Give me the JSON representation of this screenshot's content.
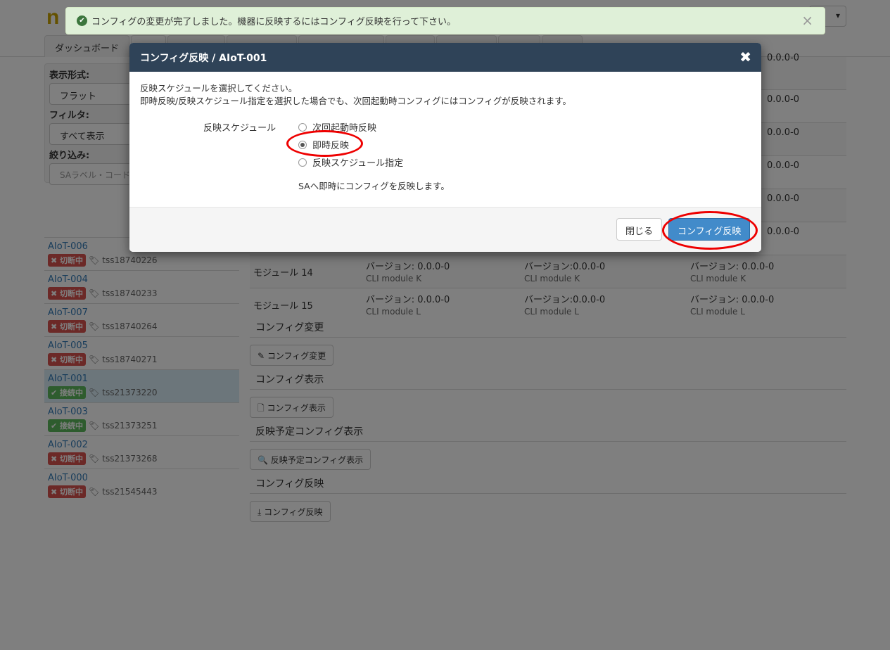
{
  "header": {
    "logo": "n",
    "user_menu": "▾"
  },
  "nav": {
    "tabs": [
      "ダッシュボード",
      "",
      "",
      "",
      "",
      "",
      "",
      "",
      ""
    ]
  },
  "left_panel": {
    "display_format_label": "表示形式:",
    "display_format_value": "フラット",
    "filter_label": "フィルタ:",
    "filter_value": "すべて表示",
    "narrow_label": "絞り込み:",
    "narrow_placeholder": "SAラベル・コード"
  },
  "devices": [
    {
      "name": "AIoT-006",
      "status": "切断中",
      "state": "off",
      "tag": "tss18740226"
    },
    {
      "name": "AIoT-004",
      "status": "切断中",
      "state": "off",
      "tag": "tss18740233"
    },
    {
      "name": "AIoT-007",
      "status": "切断中",
      "state": "off",
      "tag": "tss18740264"
    },
    {
      "name": "AIoT-005",
      "status": "切断中",
      "state": "off",
      "tag": "tss18740271"
    },
    {
      "name": "AIoT-001",
      "status": "接続中",
      "state": "on",
      "tag": "tss21373220"
    },
    {
      "name": "AIoT-003",
      "status": "接続中",
      "state": "on",
      "tag": "tss21373251"
    },
    {
      "name": "AIoT-002",
      "status": "切断中",
      "state": "off",
      "tag": "tss21373268"
    },
    {
      "name": "AIoT-000",
      "status": "切断中",
      "state": "off",
      "tag": "tss21545443"
    }
  ],
  "modules": {
    "partial_rows": [
      "0.0.0-0",
      "0.0.0-0",
      "0.0.0-0",
      "0.0.0-0",
      "0.0.0-0",
      "0.0.0-0"
    ],
    "rows": [
      {
        "name": "モジュール 14",
        "version": "バージョン: 0.0.0-0",
        "version_b": "バージョン:0.0.0-0",
        "sub": "CLI module K"
      },
      {
        "name": "モジュール 15",
        "version": "バージョン: 0.0.0-0",
        "version_b": "バージョン:0.0.0-0",
        "sub": "CLI module L"
      }
    ]
  },
  "sections": [
    {
      "title": "コンフィグ変更",
      "button": "✎ コンフィグ変更"
    },
    {
      "title": "コンフィグ表示",
      "button": "🗋 コンフィグ表示"
    },
    {
      "title": "反映予定コンフィグ表示",
      "button": "🔍 反映予定コンフィグ表示"
    },
    {
      "title": "コンフィグ反映",
      "button": "⤓ コンフィグ反映"
    }
  ],
  "alert": {
    "message": "コンフィグの変更が完了しました。機器に反映するにはコンフィグ反映を行って下さい。",
    "close": "×",
    "icon": "check-circle-icon"
  },
  "modal": {
    "title": "コンフィグ反映 / AIoT-001",
    "close": "✖",
    "line1": "反映スケジュールを選択してください。",
    "line2": "即時反映/反映スケジュール指定を選択した場合でも、次回起動時コンフィグにはコンフィグが反映されます。",
    "schedule_label": "反映スケジュール",
    "options": [
      "次回起動時反映",
      "即時反映",
      "反映スケジュール指定"
    ],
    "selected_option": "即時反映",
    "help": "SAへ即時にコンフィグを反映します。",
    "btn_close": "閉じる",
    "btn_apply": "コンフィグ反映"
  },
  "colors": {
    "modal_header": "#2f4358",
    "primary": "#428bca",
    "highlight": "#e00000",
    "alert_bg": "#dff0d8",
    "danger": "#d9534f",
    "success": "#5cb85c"
  }
}
